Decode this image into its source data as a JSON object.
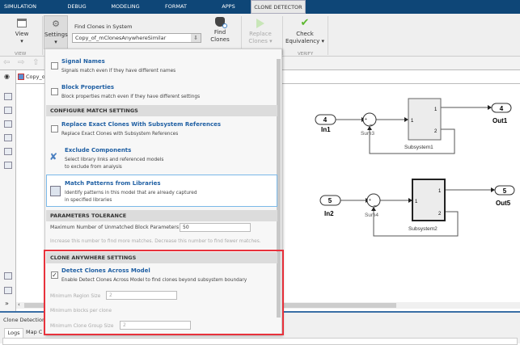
{
  "tabs": [
    {
      "label": "SIMULATION"
    },
    {
      "label": "DEBUG"
    },
    {
      "label": "MODELING"
    },
    {
      "label": "FORMAT"
    },
    {
      "label": "APPS"
    },
    {
      "label": "CLONE DETECTOR",
      "active": true
    }
  ],
  "tab_close": "×",
  "ribbon": {
    "view": "View",
    "view_group": "VIEW",
    "settings": "Settings",
    "find_label": "Find Clones in System",
    "find_value": "Copy_of_mClonesAnywhereSimilar",
    "find_clones": [
      "Find",
      "Clones"
    ],
    "replace": [
      "Replace",
      "Clones ▾"
    ],
    "check": [
      "Check",
      "Equivalency ▾"
    ],
    "verify_group": "VERIFY"
  },
  "address": "Copy_o",
  "menu": {
    "signal_names": {
      "title": "Signal Names",
      "desc": "Signals match even if they have different names",
      "checked": false
    },
    "block_properties": {
      "title": "Block Properties",
      "desc": "Block properties match even if they have different settings",
      "checked": false
    },
    "configure_header": "CONFIGURE MATCH SETTINGS",
    "replace_exact": {
      "title": "Replace Exact Clones With Subsystem References",
      "desc": "Replace Exact Clones with Subsystem References",
      "checked": false
    },
    "exclude": {
      "title": "Exclude Components",
      "desc1": "Select library links and referenced models",
      "desc2": "to exclude from analysis"
    },
    "match_patterns": {
      "title": "Match Patterns from Libraries",
      "desc1": "Identify patterns in this model that are already captured",
      "desc2": "in specified libraries"
    },
    "tolerance_header": "PARAMETERS TOLERANCE",
    "max_unmatched_label": "Maximum Number of Unmatched Block Parameters",
    "max_unmatched_value": "50",
    "tolerance_hint": "Increase this number to find more matches.   Decrease this number to find fewer matches.",
    "anywhere_header": "CLONE ANYWHERE SETTINGS",
    "detect_across": {
      "title": "Detect Clones Across Model",
      "desc": "Enable Detect Clones Across Model to find clones beyond subsystem boundary",
      "checked": true
    },
    "min_region_label": "Minimum Region Size",
    "min_region_value": "2",
    "min_blocks_label": "Minimum blocks per clone",
    "min_group_label": "Minimum Clone Group Size",
    "min_group_value": "2",
    "highlight_color": "#e8323c"
  },
  "diagram": {
    "in1": "4",
    "in1_label": "In1",
    "sum3": "Sum3",
    "sub1": "Subsystem1",
    "out1": "4",
    "out1_label": "Out1",
    "in2": "5",
    "in2_label": "In2",
    "sum4": "Sum4",
    "sub2": "Subsystem2",
    "out5": "5",
    "out5_label": "Out5",
    "port1": "1",
    "port2": "2",
    "plus": "+",
    "minus": "_"
  },
  "bottom": {
    "title": "Clone Detection",
    "tabs": [
      "Logs",
      "Map C"
    ]
  },
  "colors": {
    "tabbar": "#0e4677",
    "link": "#1f5fa3",
    "check": "#5cb82e"
  }
}
